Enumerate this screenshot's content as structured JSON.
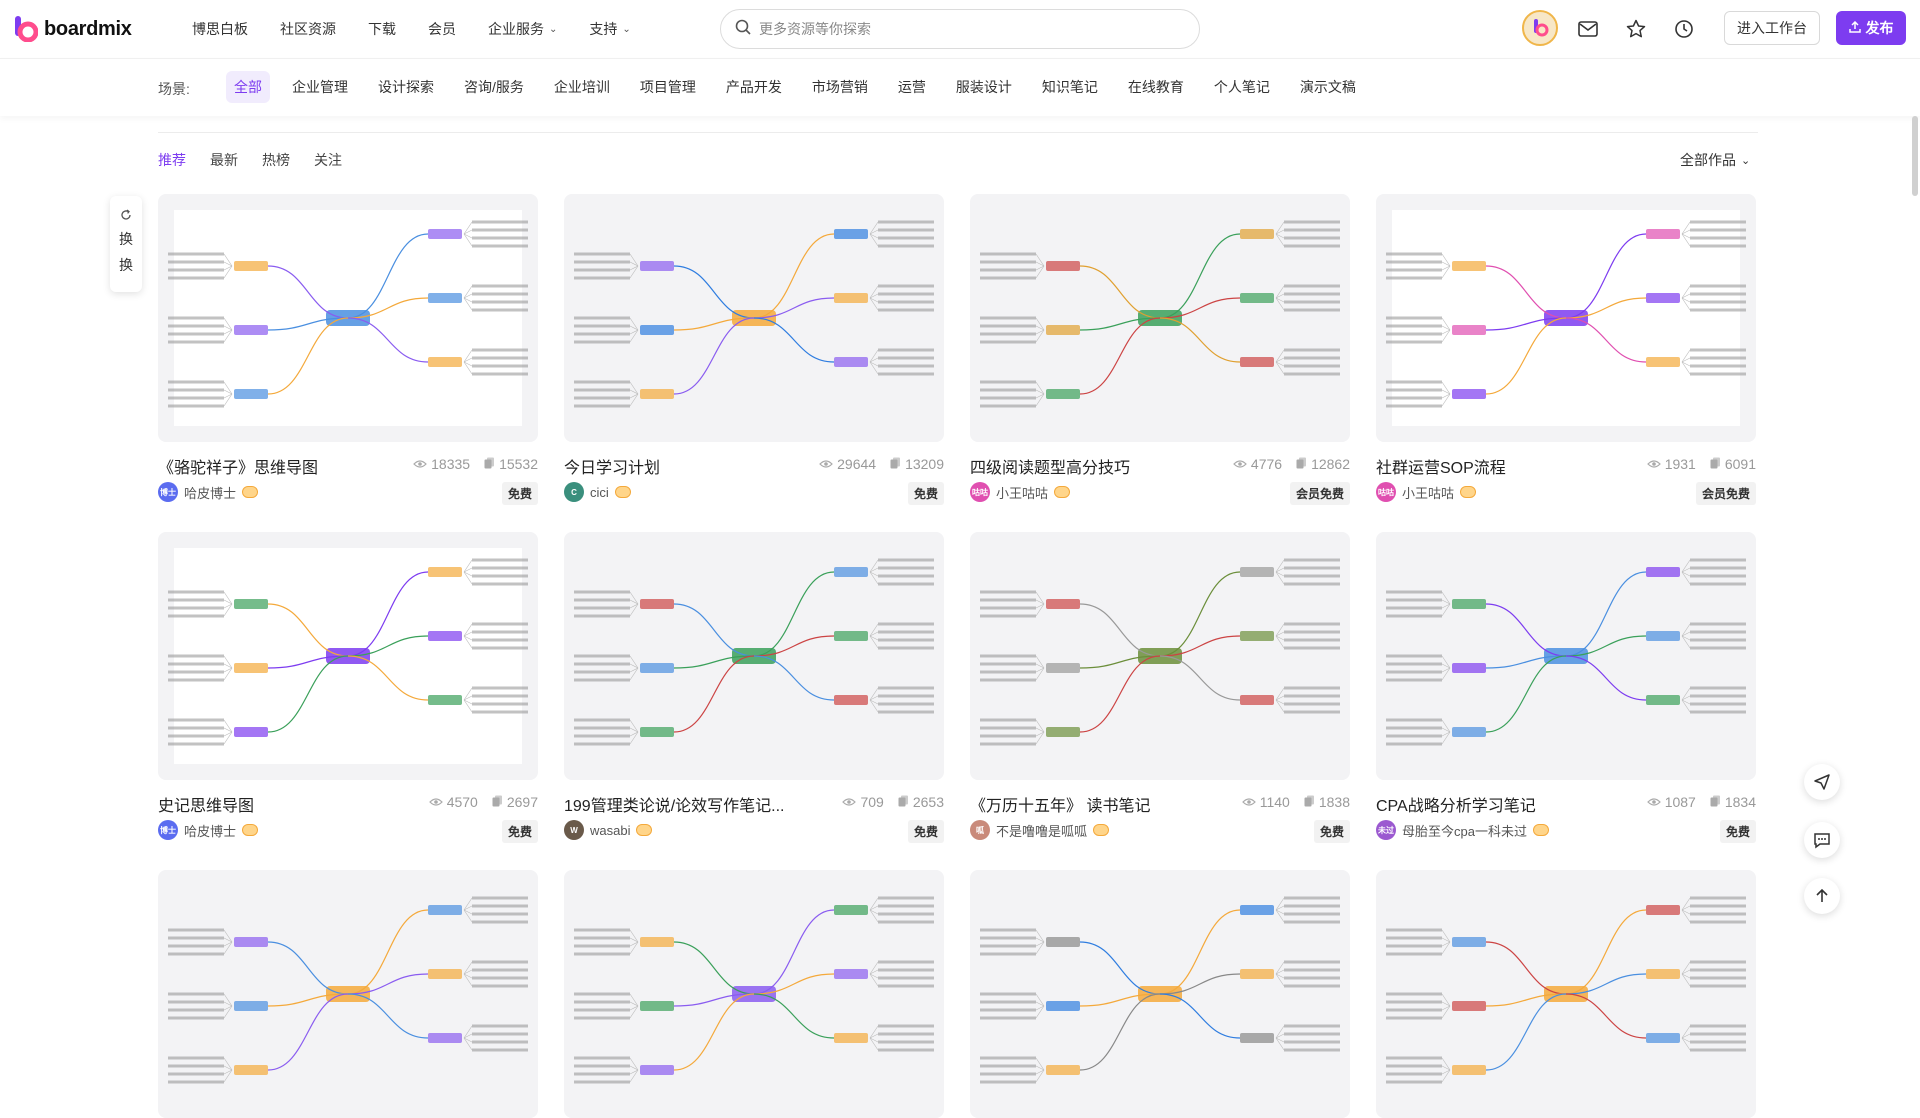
{
  "brand": {
    "name": "boardmix",
    "accent": "#7d3cf0"
  },
  "nav": {
    "items": [
      {
        "label": "博思白板",
        "dropdown": false
      },
      {
        "label": "社区资源",
        "dropdown": false
      },
      {
        "label": "下载",
        "dropdown": false
      },
      {
        "label": "会员",
        "dropdown": false
      },
      {
        "label": "企业服务",
        "dropdown": true
      },
      {
        "label": "支持",
        "dropdown": true
      }
    ]
  },
  "search": {
    "placeholder": "更多资源等你探索"
  },
  "header": {
    "workspace_label": "进入工作台",
    "publish_label": "发布",
    "icons": [
      "mail-icon",
      "star-icon",
      "clock-icon"
    ]
  },
  "scenes": {
    "label": "场景:",
    "items": [
      "全部",
      "企业管理",
      "设计探索",
      "咨询/服务",
      "企业培训",
      "项目管理",
      "产品开发",
      "市场营销",
      "运营",
      "服装设计",
      "知识笔记",
      "在线教育",
      "个人笔记",
      "演示文稿"
    ],
    "active": 0
  },
  "tabs": {
    "items": [
      "推荐",
      "最新",
      "热榜",
      "关注"
    ],
    "active": 0
  },
  "filter": {
    "label": "全部作品"
  },
  "swap": {
    "chars": [
      "换",
      "换"
    ]
  },
  "cards": [
    {
      "title": "《骆驼祥子》思维导图",
      "views": "18335",
      "copies": "15532",
      "author": "哈皮博士",
      "avatar_text": "博士",
      "avatar_color": "#5b6cf0",
      "badge": "免费"
    },
    {
      "title": "今日学习计划",
      "views": "29644",
      "copies": "13209",
      "author": "cici",
      "avatar_text": "C",
      "avatar_color": "#3a8f7d",
      "badge": "免费"
    },
    {
      "title": "四级阅读题型高分技巧",
      "views": "4776",
      "copies": "12862",
      "author": "小王咕咕",
      "avatar_text": "咕咕",
      "avatar_color": "#e04fb0",
      "badge": "会员免费"
    },
    {
      "title": "社群运营SOP流程",
      "views": "1931",
      "copies": "6091",
      "author": "小王咕咕",
      "avatar_text": "咕咕",
      "avatar_color": "#e04fb0",
      "badge": "会员免费"
    },
    {
      "title": "史记思维导图",
      "views": "4570",
      "copies": "2697",
      "author": "哈皮博士",
      "avatar_text": "博士",
      "avatar_color": "#5b6cf0",
      "badge": "免费"
    },
    {
      "title": "199管理类论说/论效写作笔记...",
      "views": "709",
      "copies": "2653",
      "author": "wasabi",
      "avatar_text": "W",
      "avatar_color": "#6a5a4a",
      "badge": "免费"
    },
    {
      "title": "《万历十五年》 读书笔记",
      "views": "1140",
      "copies": "1838",
      "author": "不是噜噜是呱呱",
      "avatar_text": "呱",
      "avatar_color": "#c98a7a",
      "badge": "免费"
    },
    {
      "title": "CPA战略分析学习笔记",
      "views": "1087",
      "copies": "1834",
      "author": "母胎至今cpa一科未过",
      "avatar_text": "未过",
      "avatar_color": "#9b59d0",
      "badge": "免费"
    },
    {
      "title": "",
      "views": "",
      "copies": "",
      "author": "",
      "avatar_text": "",
      "avatar_color": "#cccccc",
      "badge": ""
    },
    {
      "title": "",
      "views": "",
      "copies": "",
      "author": "",
      "avatar_text": "",
      "avatar_color": "#cccccc",
      "badge": ""
    },
    {
      "title": "",
      "views": "",
      "copies": "",
      "author": "",
      "avatar_text": "",
      "avatar_color": "#cccccc",
      "badge": ""
    },
    {
      "title": "",
      "views": "",
      "copies": "",
      "author": "",
      "avatar_text": "",
      "avatar_color": "#cccccc",
      "badge": ""
    }
  ],
  "float_buttons": [
    "send-icon",
    "comment-icon",
    "back-to-top-icon"
  ]
}
